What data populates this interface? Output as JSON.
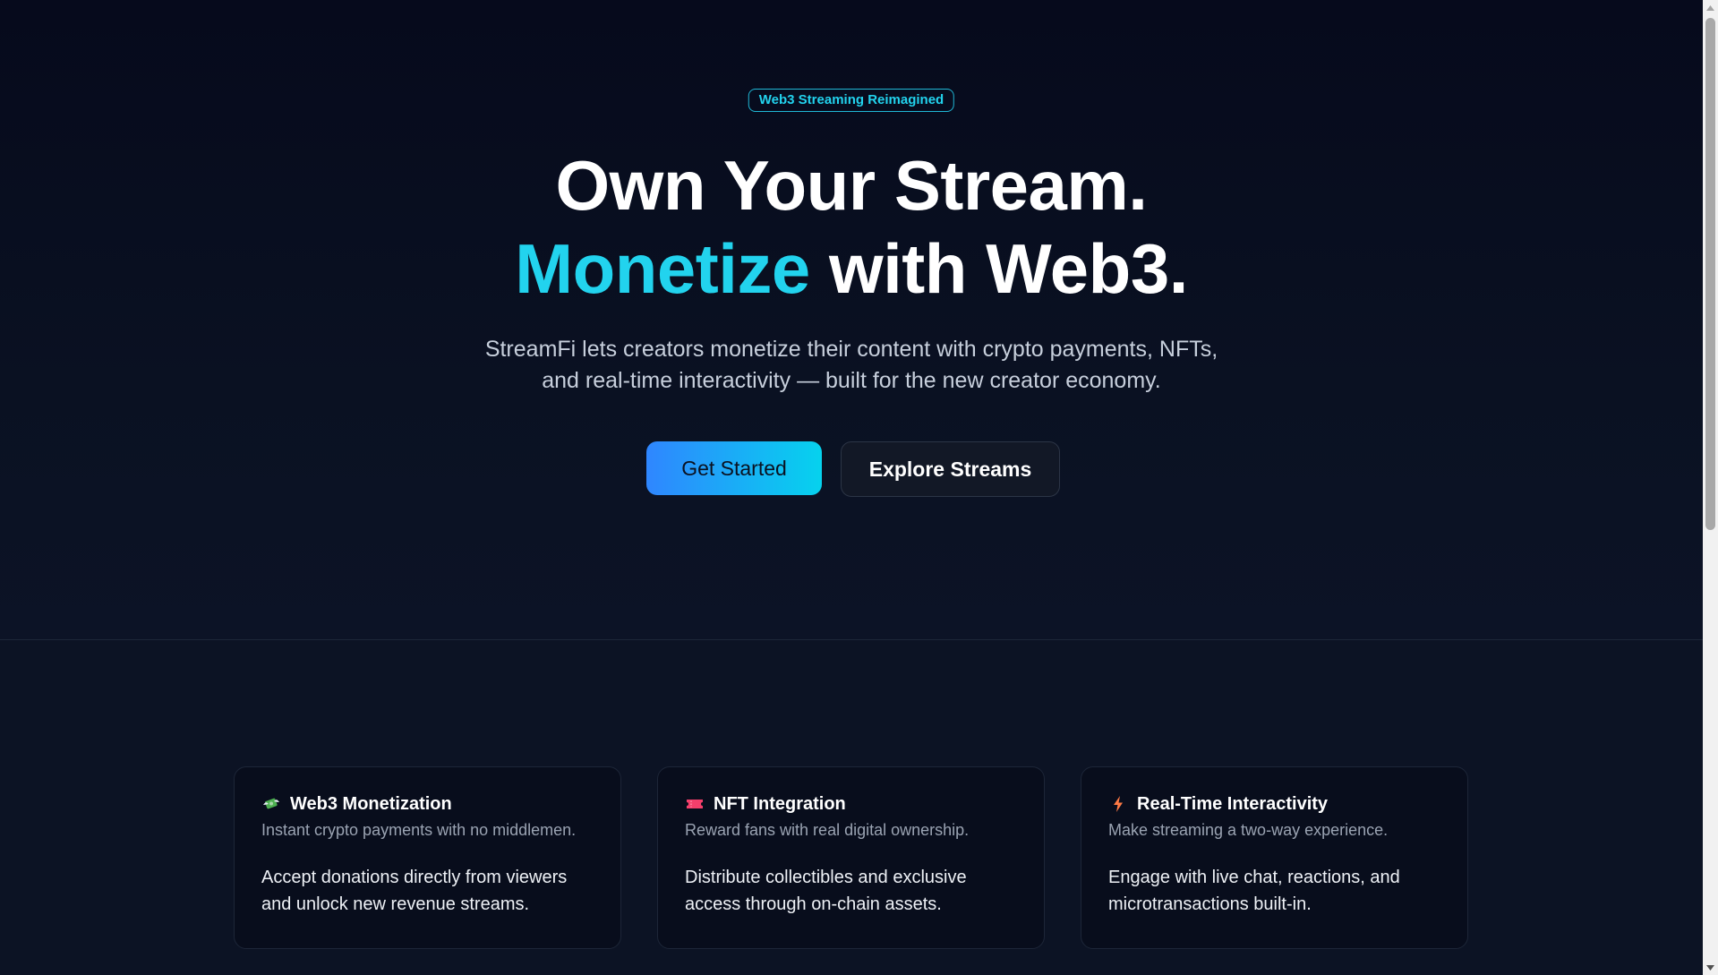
{
  "hero": {
    "badge": "Web3 Streaming Reimagined",
    "headline_line1": "Own Your Stream.",
    "headline_accent": "Monetize",
    "headline_line2_rest": " with Web3.",
    "subtitle_line1": "StreamFi lets creators monetize their content with crypto payments, NFTs,",
    "subtitle_line2": "and real-time interactivity — built for the new creator economy.",
    "primary_button": "Get Started",
    "secondary_button": "Explore Streams"
  },
  "features": [
    {
      "icon": "money-wings-icon",
      "title": "Web3 Monetization",
      "subtitle": "Instant crypto payments with no middlemen.",
      "body_line1": "Accept donations directly from viewers",
      "body_line2": "and unlock new revenue streams."
    },
    {
      "icon": "ticket-icon",
      "title": "NFT Integration",
      "subtitle": "Reward fans with real digital ownership.",
      "body_line1": "Distribute collectibles and exclusive",
      "body_line2": "access through on-chain assets."
    },
    {
      "icon": "lightning-icon",
      "title": "Real-Time Interactivity",
      "subtitle": "Make streaming a two-way experience.",
      "body_line1": "Engage with live chat, reactions, and",
      "body_line2": "microtransactions built-in."
    }
  ],
  "colors": {
    "accent": "#22d3ee",
    "background": "#070b1a",
    "primary_gradient_start": "#2f86ff",
    "primary_gradient_end": "#06d2ee"
  }
}
